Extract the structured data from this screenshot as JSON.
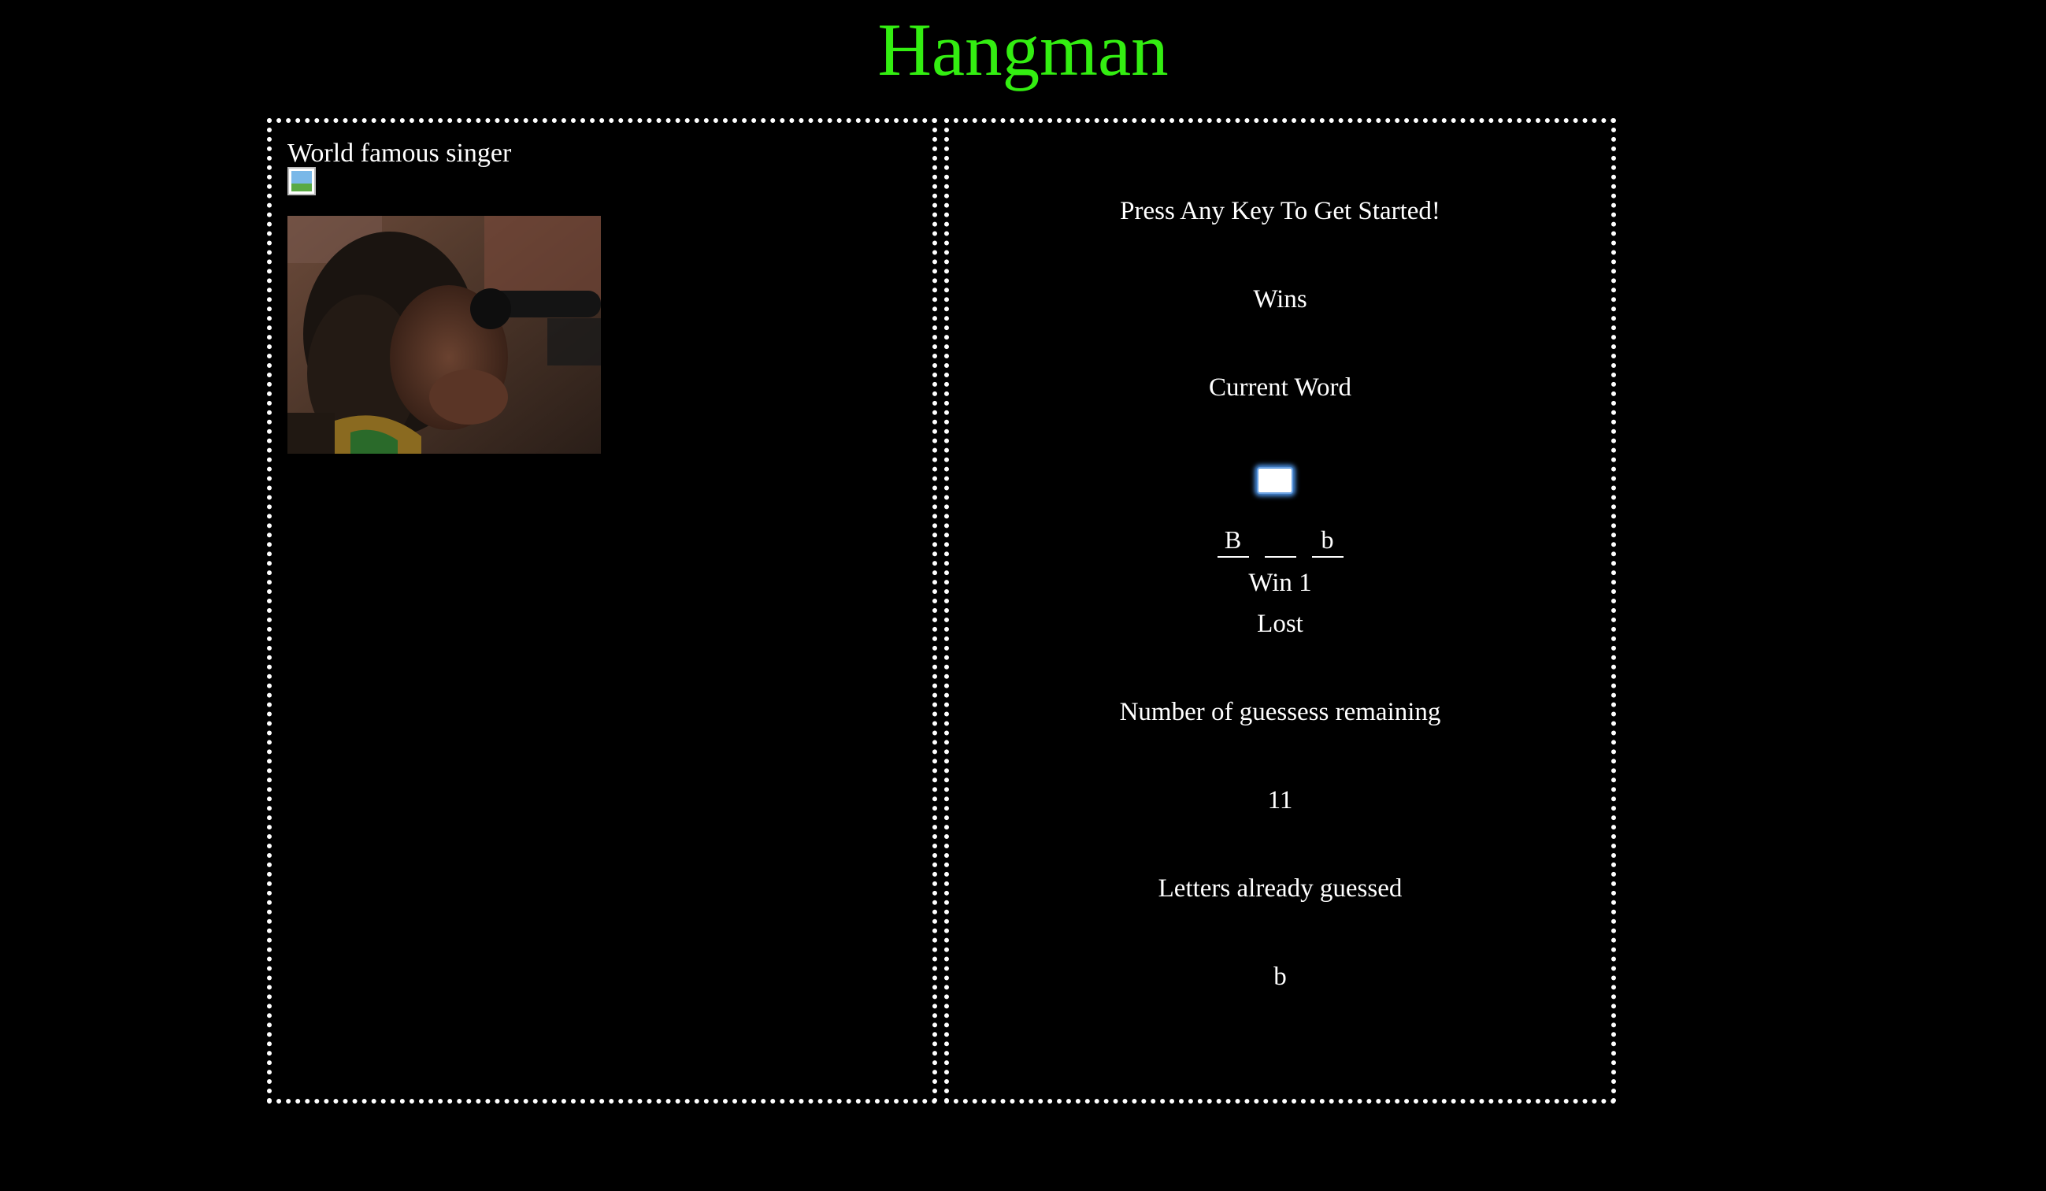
{
  "app": {
    "title": "Hangman",
    "title_color": "#33ee11",
    "background": "#000000"
  },
  "left_panel": {
    "hint": "World famous singer",
    "broken_image_icon": "broken-image-icon",
    "photo_alt": "singer photo"
  },
  "right_panel": {
    "prompt": "Press Any Key To Get Started!",
    "wins_label": "Wins",
    "current_word_label": "Current Word",
    "guess_input_value": "",
    "word_letters": [
      "B",
      "",
      "b"
    ],
    "win_line": "Win 1",
    "lost_line": "Lost",
    "guesses_label": "Number of guessess remaining",
    "guesses_remaining": "11",
    "letters_label": "Letters already guessed",
    "letters_guessed": "b"
  }
}
